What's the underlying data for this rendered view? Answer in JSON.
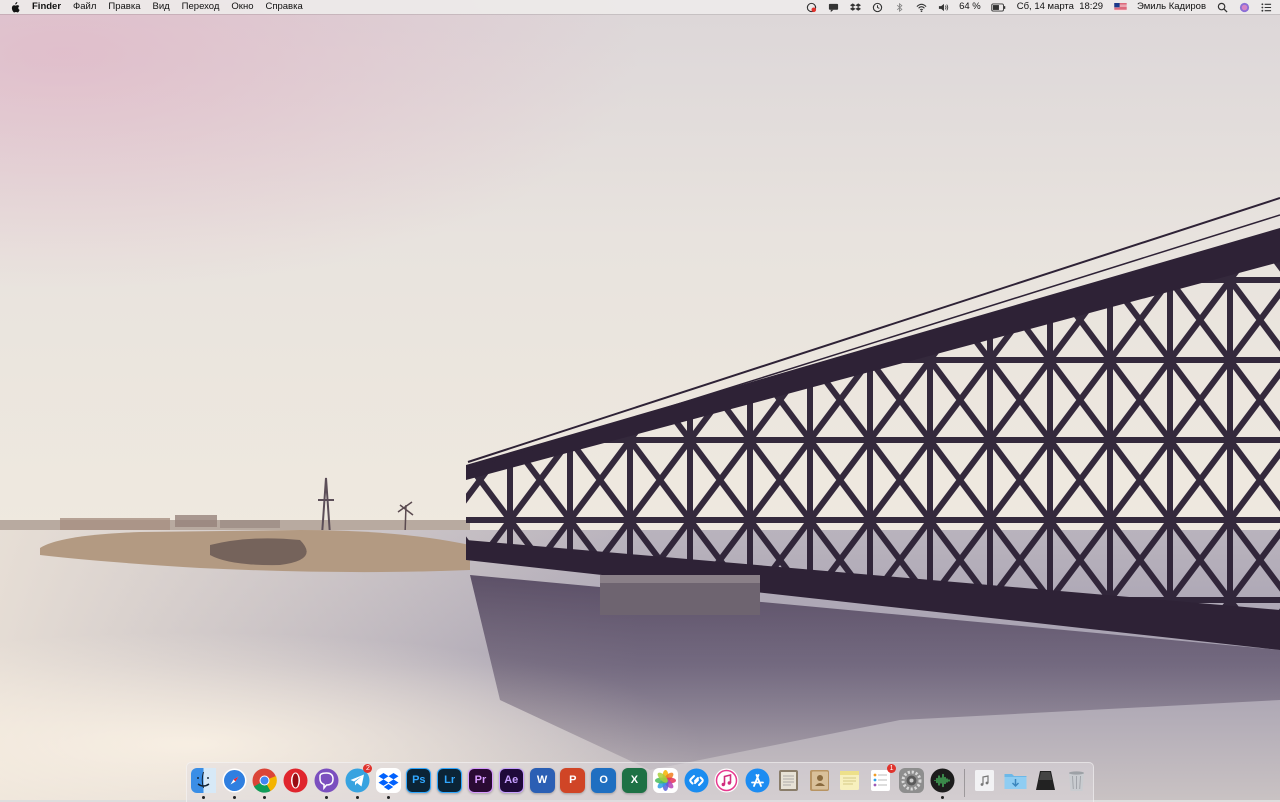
{
  "menubar": {
    "app_name": "Finder",
    "menus": [
      "Файл",
      "Правка",
      "Вид",
      "Переход",
      "Окно",
      "Справка"
    ],
    "tray_icons": [
      "opera-vpn-icon",
      "messages-icon",
      "dropbox-icon",
      "time-machine-icon",
      "bluetooth-icon",
      "wifi-icon",
      "volume-icon"
    ],
    "battery_percent": "64 %",
    "battery_level": 0.64,
    "datetime": "Сб, 14 марта  18:29",
    "input_flag": "us-flag-icon",
    "user_name": "Эмиль Кадиров"
  },
  "dock": {
    "apps": [
      {
        "name": "finder",
        "label": "",
        "color": "#3a8ee6",
        "running": true
      },
      {
        "name": "safari",
        "label": "",
        "color": "#2f7fe0",
        "running": true
      },
      {
        "name": "chrome",
        "label": "",
        "color": "#ffffff",
        "running": true
      },
      {
        "name": "opera",
        "label": "",
        "color": "#e0252d",
        "running": false
      },
      {
        "name": "viber",
        "label": "",
        "color": "#7b4fbf",
        "running": true
      },
      {
        "name": "telegram",
        "label": "",
        "color": "#37a3e0",
        "running": true,
        "badge": "2"
      },
      {
        "name": "dropbox",
        "label": "",
        "color": "#ffffff",
        "running": true
      },
      {
        "name": "photoshop",
        "label": "Ps",
        "color": "#0b2436",
        "text": "#31a8ff",
        "running": false
      },
      {
        "name": "lightroom",
        "label": "Lr",
        "color": "#0b2436",
        "text": "#31a8ff",
        "running": false
      },
      {
        "name": "premiere",
        "label": "Pr",
        "color": "#2a0a33",
        "text": "#d79bff",
        "running": false
      },
      {
        "name": "after-effects",
        "label": "Ae",
        "color": "#1f0a3a",
        "text": "#c7a0ff",
        "running": false
      },
      {
        "name": "word",
        "label": "W",
        "color": "#2b5fb4",
        "running": false
      },
      {
        "name": "powerpoint",
        "label": "P",
        "color": "#d04526",
        "running": false
      },
      {
        "name": "outlook",
        "label": "O",
        "color": "#1f6fc1",
        "running": false
      },
      {
        "name": "excel",
        "label": "X",
        "color": "#1e7145",
        "running": false
      },
      {
        "name": "photos",
        "label": "",
        "color": "#ffffff",
        "running": false
      },
      {
        "name": "shazam",
        "label": "",
        "color": "#1a8cf0",
        "running": false
      },
      {
        "name": "itunes",
        "label": "",
        "color": "#ffffff",
        "running": false
      },
      {
        "name": "app-store",
        "label": "",
        "color": "#1c8cf2",
        "running": false
      },
      {
        "name": "notes-pad",
        "label": "",
        "color": "#8a7d6a",
        "running": false
      },
      {
        "name": "contacts",
        "label": "",
        "color": "#b89463",
        "running": false
      },
      {
        "name": "stickies",
        "label": "",
        "color": "#f5f0c8",
        "running": false
      },
      {
        "name": "reminders",
        "label": "",
        "color": "#ffffff",
        "running": false,
        "badge": "1"
      },
      {
        "name": "system-preferences",
        "label": "",
        "color": "#8e8e8e",
        "running": false
      },
      {
        "name": "sound-app",
        "label": "",
        "color": "#1c1c1c",
        "running": true
      }
    ],
    "right": [
      {
        "name": "music-folder",
        "label": "",
        "color": "#e9e9ec"
      },
      {
        "name": "downloads-folder",
        "label": "",
        "color": "#6cb8e8"
      },
      {
        "name": "launchpad-stack",
        "label": "",
        "color": "#222222"
      },
      {
        "name": "trash",
        "label": "",
        "color": "#b9bcc0"
      }
    ]
  }
}
